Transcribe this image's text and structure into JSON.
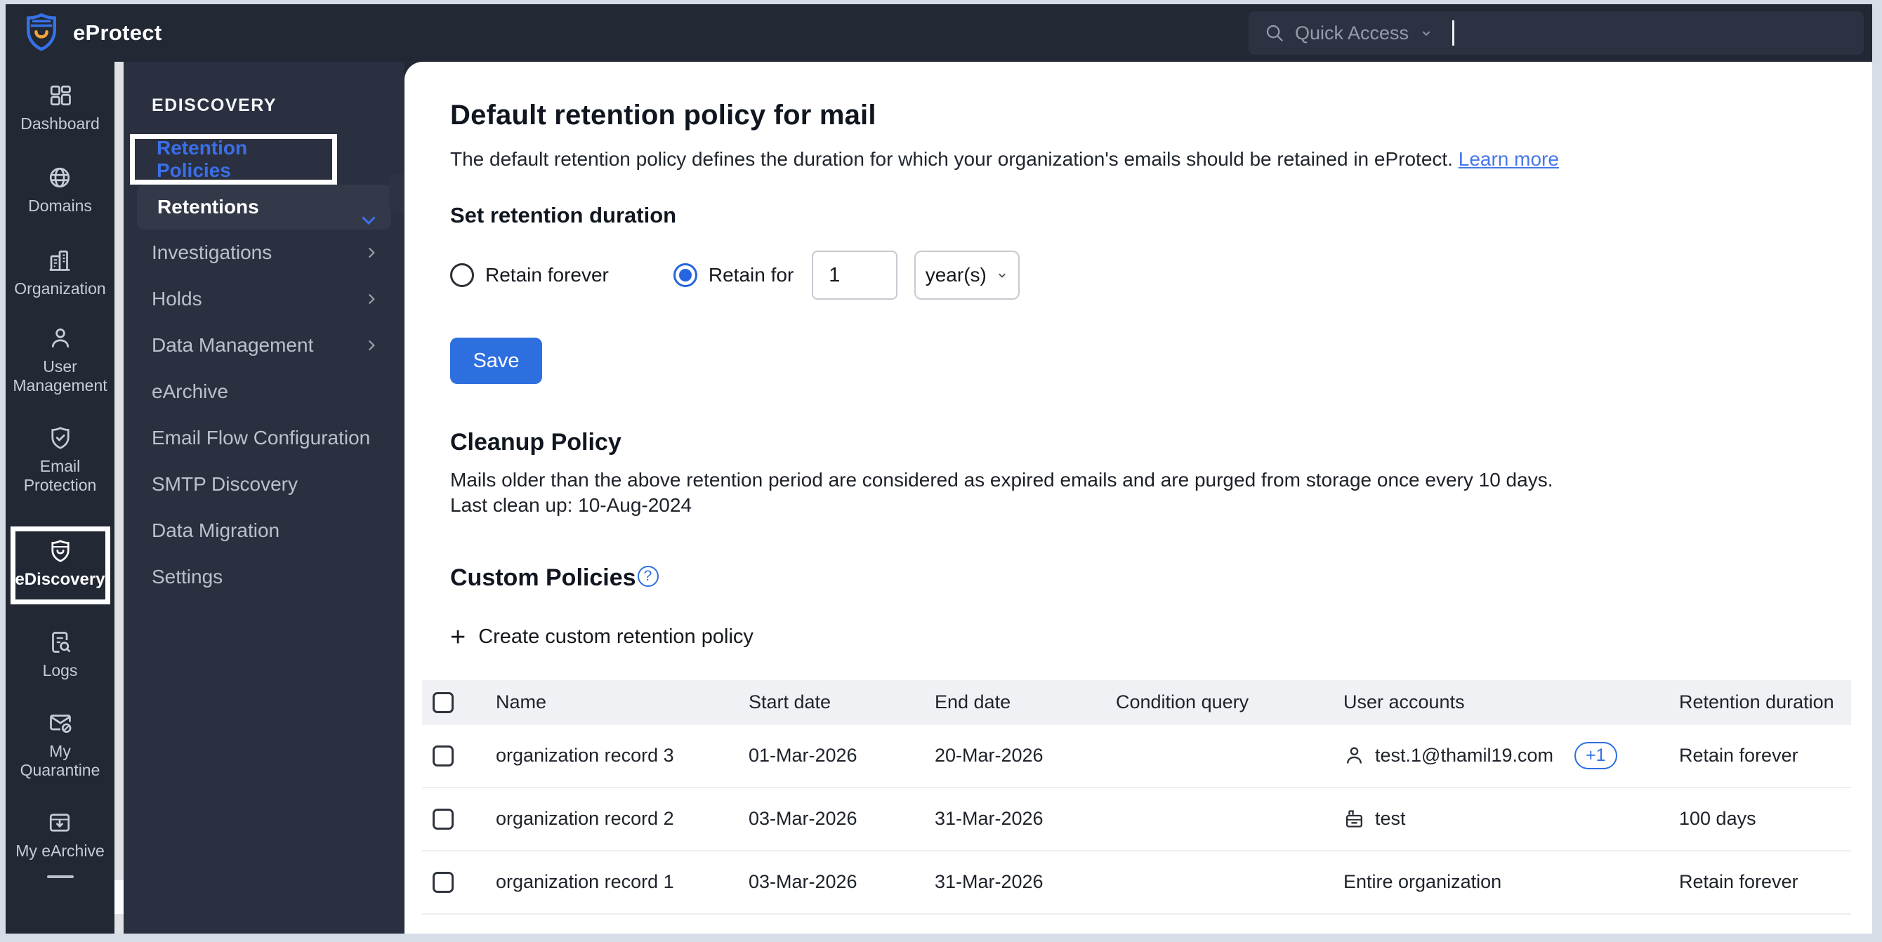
{
  "app": {
    "title": "eProtect"
  },
  "topbar": {
    "quick_access_label": "Quick Access"
  },
  "sidebar": {
    "items": [
      {
        "label": "Dashboard",
        "icon": "dashboard-icon",
        "active": false
      },
      {
        "label": "Domains",
        "icon": "globe-icon",
        "active": false
      },
      {
        "label": "Organization",
        "icon": "building-icon",
        "active": false
      },
      {
        "label": "User Management",
        "icon": "user-icon",
        "active": false
      },
      {
        "label": "Email Protection",
        "icon": "shield-check-icon",
        "active": false
      },
      {
        "label": "eDiscovery",
        "icon": "shield-smile-icon",
        "active": true,
        "highlighted": true
      },
      {
        "label": "Logs",
        "icon": "document-search-icon",
        "active": false
      },
      {
        "label": "My Quarantine",
        "icon": "mail-blocked-icon",
        "active": false
      },
      {
        "label": "My eArchive",
        "icon": "archive-download-icon",
        "active": false
      }
    ]
  },
  "secondary_menu": {
    "header": "EDISCOVERY",
    "items": [
      {
        "label": "Retention Policies",
        "selected": true,
        "expanded": true,
        "chevron": "down"
      },
      {
        "label": "Retentions",
        "active": true
      },
      {
        "label": "Investigations",
        "chevron": "right"
      },
      {
        "label": "Holds",
        "chevron": "right"
      },
      {
        "label": "Data Management",
        "chevron": "right"
      },
      {
        "label": "eArchive"
      },
      {
        "label": "Email Flow Configuration"
      },
      {
        "label": "SMTP Discovery"
      },
      {
        "label": "Data Migration"
      },
      {
        "label": "Settings"
      }
    ]
  },
  "main": {
    "title": "Default retention policy for mail",
    "description": "The default retention policy defines the duration for which your organization's emails should be retained in eProtect.",
    "learn_more": "Learn more",
    "retention": {
      "heading": "Set retention duration",
      "radio_forever": "Retain forever",
      "radio_for": "Retain for",
      "duration_value": "1",
      "duration_unit": "year(s)",
      "save_label": "Save"
    },
    "cleanup": {
      "heading": "Cleanup Policy",
      "line1": "Mails older than the above retention period are considered as expired emails and are purged from storage once every 10 days.",
      "line2": "Last clean up: 10-Aug-2024"
    },
    "custom": {
      "heading": "Custom Policies",
      "create_label": "Create custom retention policy"
    },
    "table": {
      "columns": [
        "Name",
        "Start date",
        "End date",
        "Condition query",
        "User accounts",
        "Retention duration"
      ],
      "rows": [
        {
          "name": "organization record 3",
          "start_date": "01-Mar-2026",
          "end_date": "20-Mar-2026",
          "condition_query": "",
          "user_accounts": "test.1@thamil19.com",
          "user_icon": "user-icon",
          "badge": "+1",
          "retention_duration": "Retain forever"
        },
        {
          "name": "organization record 2",
          "start_date": "03-Mar-2026",
          "end_date": "31-Mar-2026",
          "condition_query": "",
          "user_accounts": "test",
          "user_icon": "group-icon",
          "badge": "",
          "retention_duration": "100 days"
        },
        {
          "name": "organization record 1",
          "start_date": "03-Mar-2026",
          "end_date": "31-Mar-2026",
          "condition_query": "",
          "user_accounts": "Entire organization",
          "user_icon": "",
          "badge": "",
          "retention_duration": "Retain forever"
        }
      ]
    }
  },
  "colors": {
    "accent_blue": "#2e6fe0",
    "topbar_bg": "#222834",
    "secondary_bg": "#2a3040",
    "table_header_bg": "#f0f1f4",
    "highlight_border": "#ffffff"
  }
}
